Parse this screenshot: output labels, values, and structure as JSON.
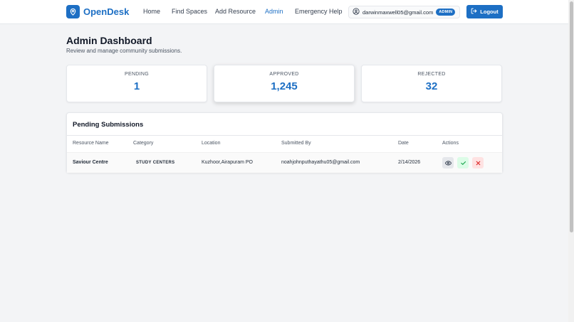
{
  "header": {
    "brand": "OpenDesk",
    "nav": [
      {
        "label": "Home",
        "active": false
      },
      {
        "label": "Find Spaces",
        "active": false
      },
      {
        "label": "Add Resource",
        "active": false
      },
      {
        "label": "Admin",
        "active": true
      },
      {
        "label": "Emergency Help",
        "active": false
      }
    ],
    "user_email": "darwinmaxwell05@gmail.com",
    "role": "ADMIN",
    "logout_label": "Logout"
  },
  "page": {
    "title": "Admin Dashboard",
    "subtitle": "Review and manage community submissions."
  },
  "stats": [
    {
      "label": "PENDING",
      "value": "1"
    },
    {
      "label": "APPROVED",
      "value": "1,245"
    },
    {
      "label": "REJECTED",
      "value": "32"
    }
  ],
  "submissions": {
    "title": "Pending Submissions",
    "columns": [
      "Resource Name",
      "Category",
      "Location",
      "Submitted By",
      "Date",
      "Actions"
    ],
    "rows": [
      {
        "name": "Saviour Centre",
        "category": "STUDY CENTERS",
        "location": "Kuzhoor,Airapuram PO",
        "submitted_by": "noahjohnputhayathu05@gmail.com",
        "date": "2/14/2026"
      }
    ]
  },
  "colors": {
    "primary": "#1d6fc4",
    "approve_bg": "#dcfce7",
    "reject_bg": "#fee2e2"
  },
  "icons": {
    "brand": "map-pin-icon",
    "user": "user-circle-icon",
    "logout": "logout-icon",
    "view": "eye-icon",
    "approve": "check-icon",
    "reject": "x-icon"
  }
}
